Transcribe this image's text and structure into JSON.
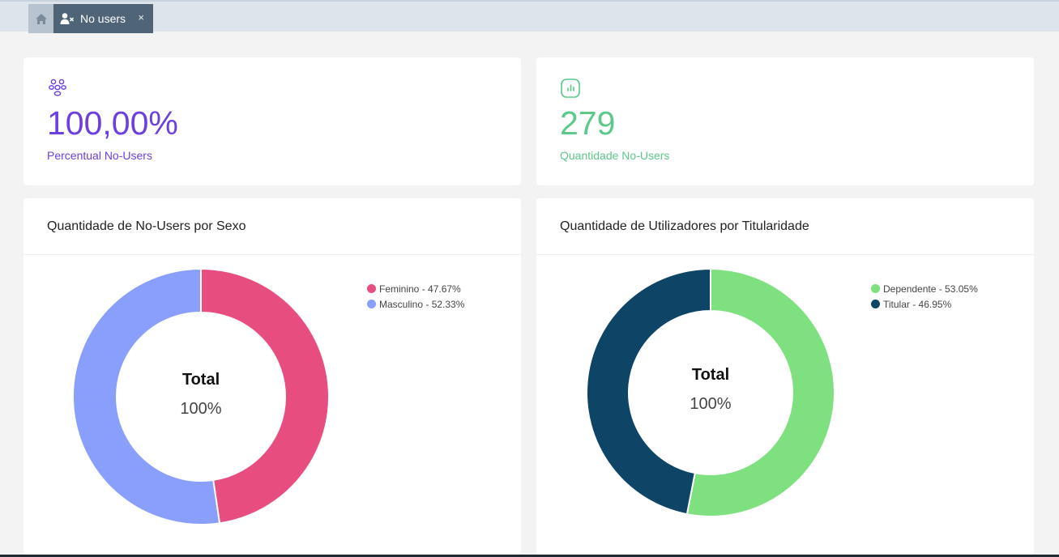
{
  "tabs": {
    "home_icon": "home-icon",
    "active": {
      "icon": "user-x-icon",
      "label": "No users",
      "close": "×"
    }
  },
  "stats": [
    {
      "icon": "users-group-icon",
      "value": "100,00%",
      "label": "Percentual No-Users",
      "color": "#6c3fe0"
    },
    {
      "icon": "chart-square-icon",
      "value": "279",
      "label": "Quantidade No-Users",
      "color": "#5cc98a"
    }
  ],
  "charts": {
    "sexo": {
      "title": "Quantidade de No-Users por Sexo",
      "center_title": "Total",
      "center_value": "100%"
    },
    "titularidade": {
      "title": "Quantidade de Utilizadores por Titularidade",
      "center_title": "Total",
      "center_value": "100%"
    }
  },
  "chart_data": [
    {
      "type": "pie",
      "title": "Quantidade de No-Users por Sexo",
      "series": [
        {
          "name": "Feminino",
          "value": 47.67,
          "legend": "Feminino - 47.67%",
          "color": "#e84d80"
        },
        {
          "name": "Masculino",
          "value": 52.33,
          "legend": "Masculino - 52.33%",
          "color": "#8a9ffb"
        }
      ]
    },
    {
      "type": "pie",
      "title": "Quantidade de Utilizadores por Titularidade",
      "series": [
        {
          "name": "Dependente",
          "value": 53.05,
          "legend": "Dependente - 53.05%",
          "color": "#7fe07f"
        },
        {
          "name": "Titular",
          "value": 46.95,
          "legend": "Titular - 46.95%",
          "color": "#0e4566"
        }
      ]
    }
  ]
}
